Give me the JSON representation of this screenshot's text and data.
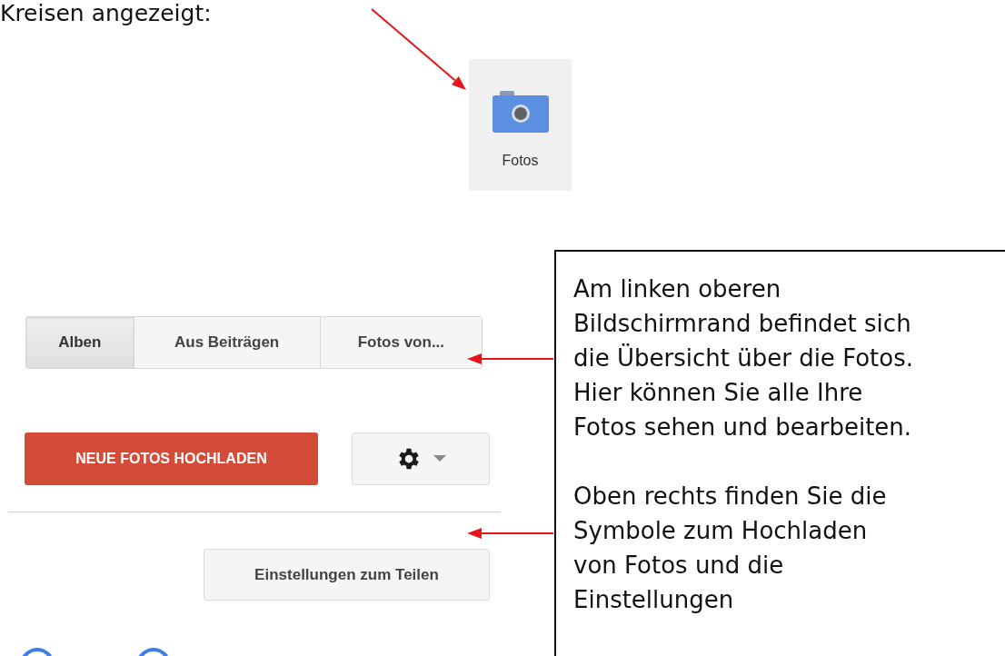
{
  "intro_text": "Kreisen angezeigt:",
  "photos_tile": {
    "label": "Fotos"
  },
  "tabs": [
    {
      "label": "Alben",
      "selected": true
    },
    {
      "label": "Aus Beiträgen",
      "selected": false
    },
    {
      "label": "Fotos von...",
      "selected": false
    }
  ],
  "upload_button": "NEUE FOTOS HOCHLADEN",
  "share_settings_button": "Einstellungen zum Teilen",
  "callout": {
    "paragraphs": [
      "Am linken oberen\nBildschirmrand befindet sich\ndie Übersicht über die Fotos.\nHier können Sie alle Ihre\nFotos sehen und bearbeiten.",
      "Oben rechts finden Sie die\nSymbole zum Hochladen\nvon Fotos und die\nEinstellungen"
    ]
  }
}
